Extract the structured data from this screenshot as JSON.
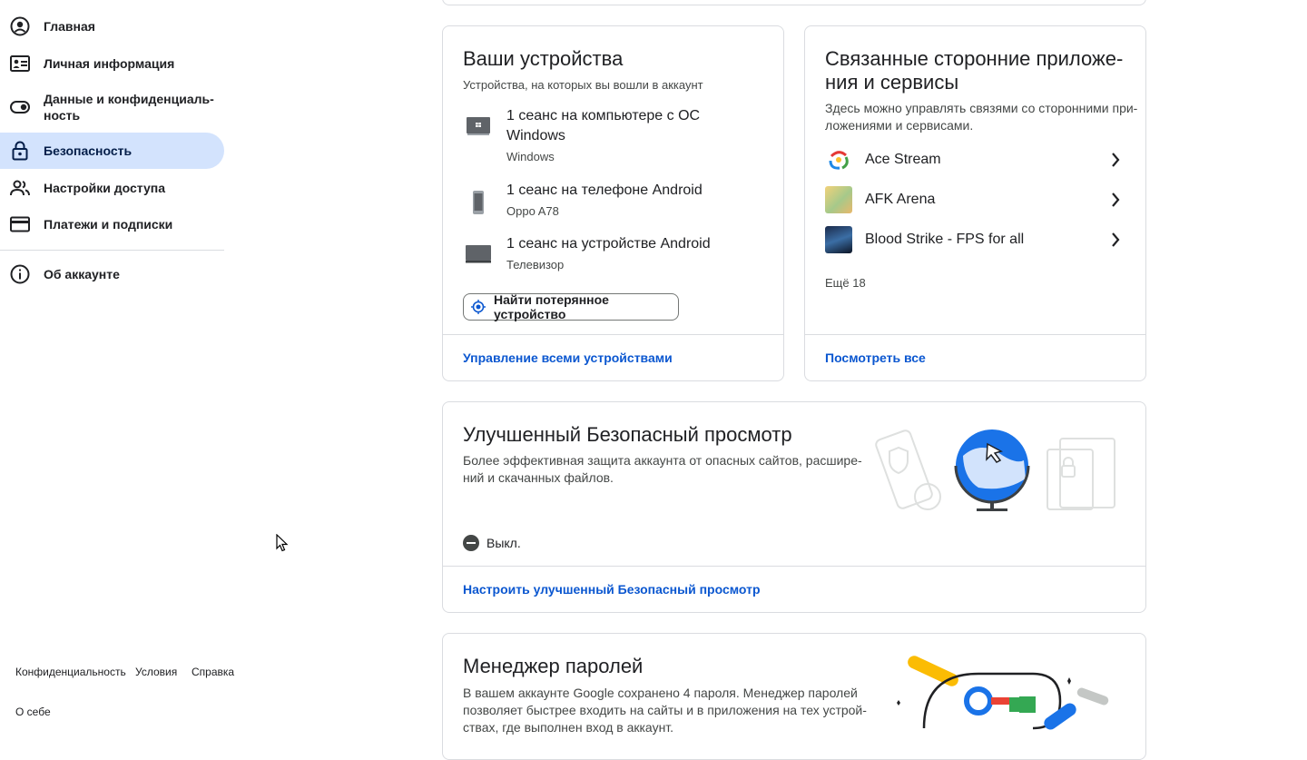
{
  "sidebar": {
    "items": [
      {
        "label": "Главная",
        "icon": "account-circle-icon"
      },
      {
        "label": "Личная информация",
        "icon": "id-card-icon"
      },
      {
        "label": "Данные и конфиденциаль-\nность",
        "icon": "toggle-icon"
      },
      {
        "label": "Безопасность",
        "icon": "lock-icon",
        "active": true
      },
      {
        "label": "Настройки доступа",
        "icon": "people-icon"
      },
      {
        "label": "Платежи и подписки",
        "icon": "credit-card-icon"
      },
      {
        "label": "Об аккаунте",
        "icon": "info-icon"
      }
    ]
  },
  "footer": {
    "privacy": "Конфиденциальность",
    "terms": "Условия",
    "help": "Справка",
    "about": "О себе"
  },
  "devices": {
    "title": "Ваши устройства",
    "subtitle": "Устройства, на которых вы вошли в аккаунт",
    "items": [
      {
        "title": "1 сеанс на компьютере с ОС Windows",
        "sub": "Windows",
        "icon": "laptop-icon"
      },
      {
        "title": "1 сеанс на телефоне Android",
        "sub": "Oppo A78",
        "icon": "phone-icon"
      },
      {
        "title": "1 сеанс на устройстве Android",
        "sub": "Телевизор",
        "icon": "tv-icon"
      }
    ],
    "find_button": "Найти потерянное устройство",
    "manage_link": "Управление всеми устройствами"
  },
  "apps": {
    "title": "Связанные сторонние приложе-\nния и сервисы",
    "subtitle": "Здесь можно управлять связями со сторонними при-\nложениями и сервисами.",
    "items": [
      {
        "name": "Ace Stream"
      },
      {
        "name": "AFK Arena"
      },
      {
        "name": "Blood Strike - FPS for all"
      }
    ],
    "more": "Ещё 18",
    "view_all": "Посмотреть все"
  },
  "safe_browsing": {
    "title": "Улучшенный Безопасный просмотр",
    "subtitle": "Более эффективная защита аккаунта от опасных сайтов, расшире-\nний и скачанных файлов.",
    "status": "Выкл.",
    "link": "Настроить улучшенный Безопасный просмотр"
  },
  "passwords": {
    "title": "Менеджер паролей",
    "text": "В вашем аккаунте Google сохранено 4 пароля. Менеджер паролей\nпозволяет быстрее входить на сайты и в приложения на тех устрой-\nствах, где выполнен вход в аккаунт."
  },
  "colors": {
    "accent": "#0b57d0",
    "active_bg": "#d3e3fd",
    "border": "#dadce0"
  }
}
